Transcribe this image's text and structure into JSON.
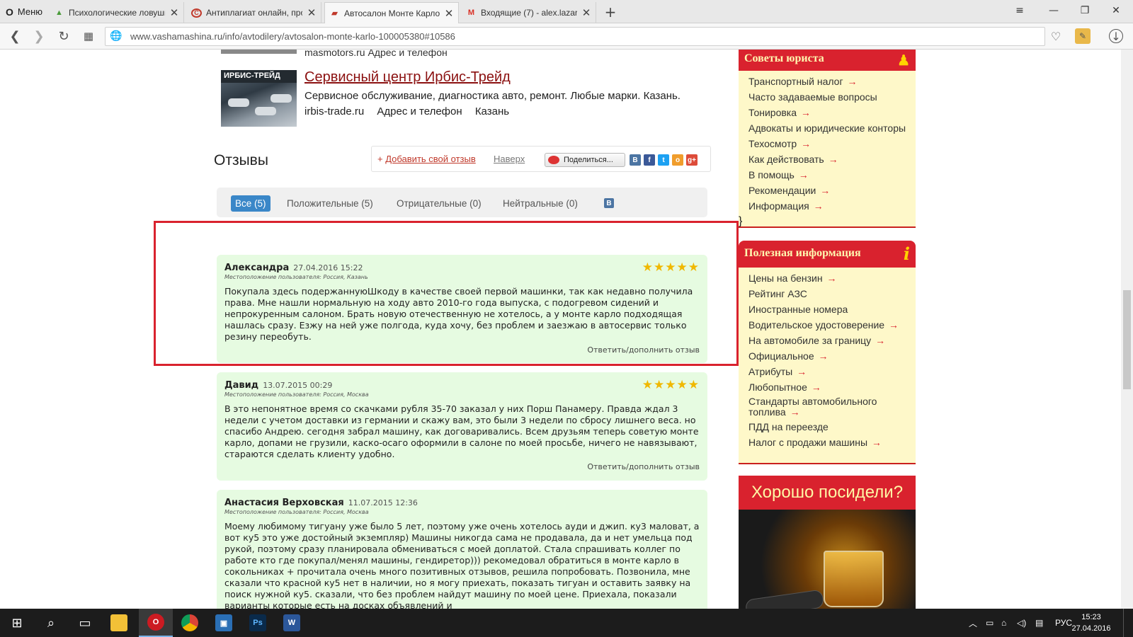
{
  "browser": {
    "menu_label": "Меню",
    "tabs": [
      {
        "title": "Психологические ловушк",
        "favicon": "leaf"
      },
      {
        "title": "Антиплагиат онлайн, про",
        "favicon": "copyright"
      },
      {
        "title": "Автосалон Монте Карло",
        "favicon": "car"
      },
      {
        "title": "Входящие (7) - alex.lazare",
        "favicon": "gmail"
      }
    ],
    "url": "www.vashamashina.ru/info/avtodilery/avtosalon-monte-karlo-100005380#10586"
  },
  "prev_listing": {
    "text": "masmotors.ru    Адрес и телефон"
  },
  "service": {
    "image_label": "ИРБИС-ТРЕЙД",
    "title": "Сервисный центр Ирбис-Трейд",
    "description": "Сервисное обслуживание, диагностика авто, ремонт. Любые марки. Казань.",
    "site": "irbis-trade.ru",
    "address_link": "Адрес и телефон",
    "city": "Казань"
  },
  "reviews_section": {
    "heading": "Отзывы",
    "add_plus": "+",
    "add_label": "Добавить свой отзыв",
    "top_link": "Наверх",
    "share_label": "Поделиться...",
    "social": [
      "В",
      "f",
      "t",
      "o",
      "g+"
    ],
    "filters": [
      "Все (5)",
      "Положительные (5)",
      "Отрицательные (0)",
      "Нейтральные (0)"
    ],
    "vk_label": "В"
  },
  "reviews": [
    {
      "name": "Александра",
      "date": "27.04.2016 15:22",
      "location": "Местоположение пользователя: Россия, Казань",
      "stars": "★★★★★",
      "text": "Покупала здесь подержаннуюШкоду в качестве своей первой машинки, так как недавно получила права. Мне нашли нормальную на ходу авто 2010-го года выпуска, с подогревом сидений и непрокуренным салоном. Брать новую отечественную не хотелось, а у монте карло подходящая нашлась сразу. Езжу на ней уже полгода, куда хочу, без проблем и заезжаю в автосервис только резину переобуть.",
      "reply": "Ответить/дополнить отзыв"
    },
    {
      "name": "Давид",
      "date": "13.07.2015 00:29",
      "location": "Местоположение пользователя: Россия, Москва",
      "stars": "★★★★★",
      "text": "В это непонятное время со скачками рубля 35-70 заказал у них Порш Панамеру. Правда ждал 3 недели с учетом доставки из германии и скажу вам, это были 3 недели по сбросу лишнего веса. но спасибо Андрею. сегодня забрал машину, как договаривались. Всем друзьям теперь советую монте карло, допами не грузили, каско-осаго оформили в салоне по моей просьбе, ничего не навязывают, стараются сделать клиенту удобно.",
      "reply": "Ответить/дополнить отзыв"
    },
    {
      "name": "Анастасия Верховская",
      "date": "11.07.2015 12:36",
      "location": "Местоположение пользователя: Россия, Москва",
      "text": "Моему любимому тигуану уже было 5 лет, поэтому уже очень хотелось ауди и джип. ку3 маловат, а вот ку5 это уже достойный экземпляр) Машины никогда сама не продавала, да и нет умельца под рукой, поэтому сразу планировала обмениваться с моей доплатой. Стала спрашивать коллег по работе кто где покупал/менял машины, гендиретор))) рекомедовал обратиться в монте карло в сокольниках + прочитала очень много позитивных отзывов, решила попробовать. Позвонила, мне сказали что красной ку5 нет в наличии, но я могу приехать, показать тигуан и оставить заявку на поиск нужной ку5. сказали, что без проблем найдут машину по моей цене. Приехала, показали варианты которые есть на досках объявлений и"
    }
  ],
  "sidebar": {
    "lawyer": {
      "title": "Советы юриста",
      "items": [
        {
          "label": "Транспортный налог",
          "arrow": "→"
        },
        {
          "label": "Часто задаваемые вопросы",
          "arrow": ""
        },
        {
          "label": "Тонировка",
          "arrow": "→"
        },
        {
          "label": "Адвокаты и юридические конторы",
          "arrow": ""
        },
        {
          "label": "Техосмотр",
          "arrow": "→"
        },
        {
          "label": "Как действовать",
          "arrow": "→"
        },
        {
          "label": "В помощь",
          "arrow": "→"
        },
        {
          "label": "Рекомендации",
          "arrow": "→"
        },
        {
          "label": "Информация",
          "arrow": "→"
        }
      ]
    },
    "info": {
      "title": "Полезная информация",
      "icon": "i",
      "items": [
        {
          "label": "Цены на бензин",
          "arrow": "→"
        },
        {
          "label": "Рейтинг АЗС",
          "arrow": ""
        },
        {
          "label": "Иностранные номера",
          "arrow": ""
        },
        {
          "label": "Водительское удостоверение",
          "arrow": "→"
        },
        {
          "label": "На автомобиле за границу",
          "arrow": "→"
        },
        {
          "label": "Официальное",
          "arrow": "→"
        },
        {
          "label": "Атрибуты",
          "arrow": "→"
        },
        {
          "label": "Любопытное",
          "arrow": "→"
        },
        {
          "label": "Стандарты автомобильного топлива",
          "arrow": "→"
        },
        {
          "label": "ПДД на переезде",
          "arrow": ""
        },
        {
          "label": "Налог с продажи машины",
          "arrow": "→"
        }
      ]
    },
    "ad_title": "Хорошо посидели?"
  },
  "taskbar": {
    "lang": "РУС",
    "time": "15:23",
    "date": "27.04.2016"
  },
  "colors": {
    "accent_red": "#d9222e",
    "review_bg": "#e6fbe1",
    "filter_active": "#3a87c8",
    "sidebar_bg": "#fef8c9"
  }
}
